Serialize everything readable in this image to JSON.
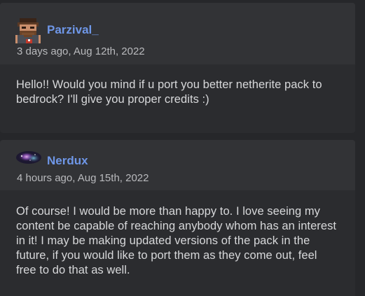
{
  "comments": [
    {
      "username": "Parzival_",
      "timestamp": "3 days ago, Aug 12th, 2022",
      "avatar_icon": "pixel-character-avatar-icon",
      "body": "Hello!! Would you mind if u port you better netherite pack to bedrock? I'll give you proper credits :)"
    },
    {
      "username": "Nerdux",
      "timestamp": "4 hours ago, Aug 15th, 2022",
      "avatar_icon": "nebula-avatar-icon",
      "body": "Of course! I would be more than happy to. I love seeing my content be capable of reaching anybody whom has an interest in it! I may be making updated versions of the pack in the future, if you would like to port them as they come out, feel free to do that as well."
    }
  ],
  "colors": {
    "background": "#26272a",
    "header": "#323336",
    "body": "#2b2c2f",
    "username": "#6f97e8",
    "text": "#d7d8da",
    "muted": "#b9babd"
  }
}
